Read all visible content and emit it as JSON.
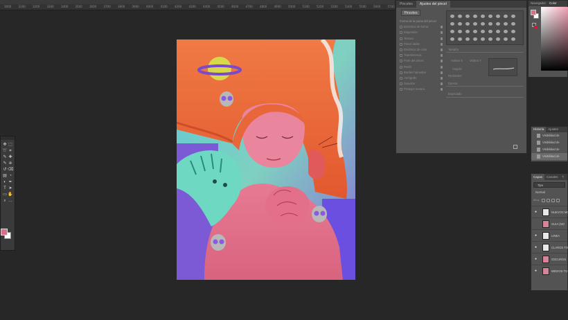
{
  "ruler": {
    "ticks": [
      "3000",
      "3100",
      "3200",
      "3300",
      "3400",
      "3500",
      "3600",
      "3700",
      "3800",
      "3900",
      "4000",
      "4100",
      "4200",
      "4300",
      "4400",
      "4500",
      "4600",
      "4700",
      "4800",
      "4900",
      "5000",
      "5100",
      "5200",
      "5300",
      "5400",
      "5500",
      "5600",
      "5700"
    ]
  },
  "toolbar": {
    "foreground_color": "#d4708a",
    "background_color": "#ffffff",
    "tools": [
      "move-icon",
      "marquee-icon",
      "lasso-icon",
      "crop-icon",
      "eyedropper-icon",
      "healing-icon",
      "brush-icon",
      "stamp-icon",
      "history-brush-icon",
      "eraser-icon",
      "gradient-icon",
      "blur-icon",
      "dodge-icon",
      "pen-icon",
      "type-icon",
      "path-select-icon",
      "shape-icon",
      "hand-icon",
      "zoom-icon",
      "more-icon"
    ]
  },
  "brush_panel": {
    "tabs": [
      "Pinceles",
      "Ajustes del pincel"
    ],
    "active_tab": "Ajustes del pincel",
    "brushes_button": "Pinceles",
    "options": [
      "Forma de la punta del pincel",
      "Dinámica de forma",
      "Dispersión",
      "Textura",
      "Pincel doble",
      "Dinámica de color",
      "Transferencia",
      "Pose del pincel",
      "Ruido",
      "Bordes húmedos",
      "Aerógrafo",
      "Suavizar",
      "Proteger textura"
    ],
    "labels": {
      "tamano": "Tamaño",
      "volteo_x": "Voltear X",
      "volteo_y": "Voltear Y",
      "angulo": "Ángulo:",
      "redondez": "Redondez:",
      "dureza": "Dureza",
      "espaciado": "Espaciado"
    }
  },
  "color_panel": {
    "tabs": [
      "Navegador",
      "Color"
    ],
    "active_tab": "Color",
    "foreground": "#d4708a",
    "background": "#ffffff"
  },
  "history_panel": {
    "tabs": [
      "Historia",
      "Ajustes"
    ],
    "active_tab": "Historia",
    "items": [
      "Visibilidad de",
      "Visibilidad de",
      "Visibilidad de",
      "Visibilidad de"
    ]
  },
  "layers_panel": {
    "tabs": [
      "Capas",
      "Canales",
      "T"
    ],
    "active_tab": "Capas",
    "kind_filter": "Tipo",
    "blend_mode": "Normal",
    "lock_label": "Bloq.:",
    "layers": [
      {
        "name": "NUEVOS MO",
        "visible": true,
        "thumb": "white"
      },
      {
        "name": "GUIA (NO",
        "visible": false,
        "thumb": "pic"
      },
      {
        "name": "LINEA",
        "visible": true,
        "thumb": "white"
      },
      {
        "name": "CLAROS TO",
        "visible": true,
        "thumb": "white"
      },
      {
        "name": "OSCUROS",
        "visible": true,
        "thumb": "pic"
      },
      {
        "name": "MEDIOS TO",
        "visible": true,
        "thumb": "pic"
      }
    ]
  }
}
